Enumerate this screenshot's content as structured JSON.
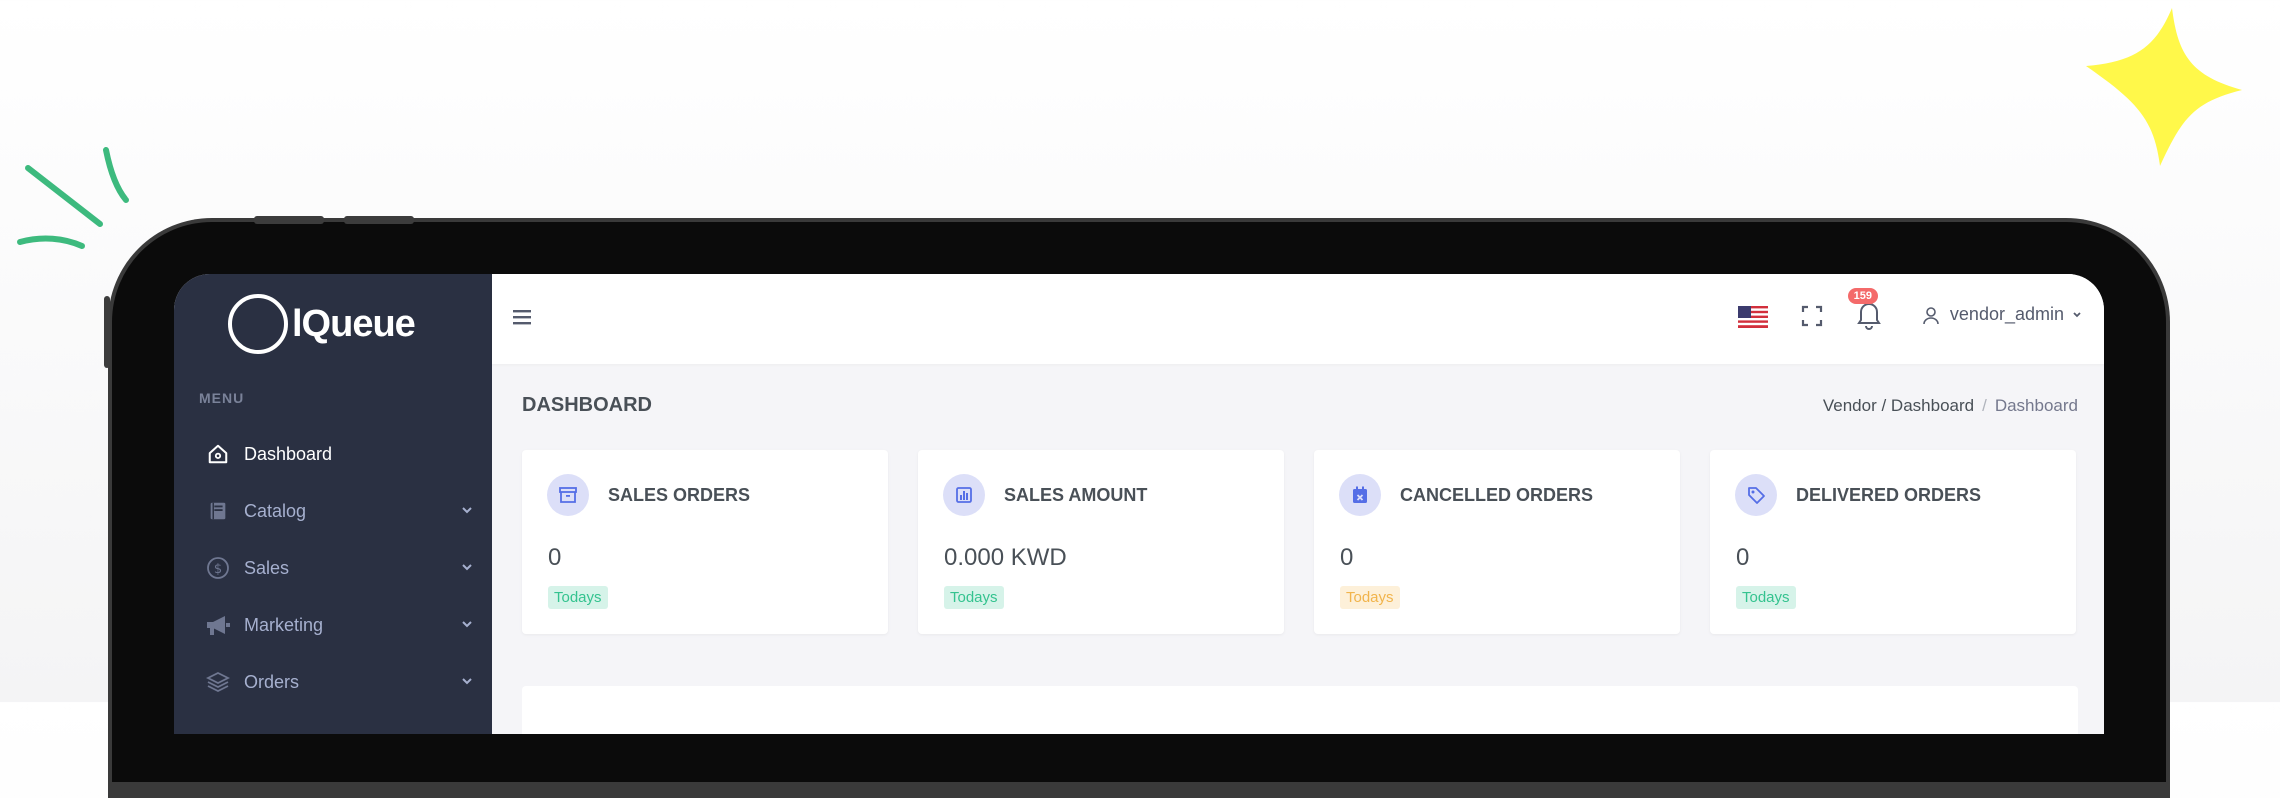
{
  "brand": {
    "name": "lQueue"
  },
  "sidebar": {
    "menu_title": "MENU",
    "items": [
      {
        "label": "Dashboard",
        "icon": "home-icon",
        "active": true,
        "has_children": false
      },
      {
        "label": "Catalog",
        "icon": "book-icon",
        "active": false,
        "has_children": true
      },
      {
        "label": "Sales",
        "icon": "dollar-icon",
        "active": false,
        "has_children": true
      },
      {
        "label": "Marketing",
        "icon": "megaphone-icon",
        "active": false,
        "has_children": true
      },
      {
        "label": "Orders",
        "icon": "layers-icon",
        "active": false,
        "has_children": true
      }
    ]
  },
  "topbar": {
    "language_flag": "us-flag-icon",
    "notification_count": "159",
    "user_name": "vendor_admin"
  },
  "page": {
    "title": "DASHBOARD",
    "breadcrumb": {
      "parent": "Vendor / Dashboard",
      "current": "Dashboard"
    }
  },
  "cards": [
    {
      "title": "SALES ORDERS",
      "value": "0",
      "badge": "Todays",
      "badge_color": "#34c38f",
      "icon": "archive-icon"
    },
    {
      "title": "SALES AMOUNT",
      "value": "0.000 KWD",
      "badge": "Todays",
      "badge_color": "#34c38f",
      "icon": "chart-icon"
    },
    {
      "title": "CANCELLED ORDERS",
      "value": "0",
      "badge": "Todays",
      "badge_color": "#f1b44c",
      "icon": "calendar-x-icon"
    },
    {
      "title": "DELIVERED ORDERS",
      "value": "0",
      "badge": "Todays",
      "badge_color": "#34c38f",
      "icon": "tag-icon"
    }
  ],
  "colors": {
    "sidebar_bg": "#2a3042",
    "accent": "#556ee6",
    "success": "#34c38f",
    "warning": "#f1b44c",
    "danger": "#f46a6a",
    "deco_yellow": "#fff84a",
    "deco_green": "#3dba7e"
  }
}
